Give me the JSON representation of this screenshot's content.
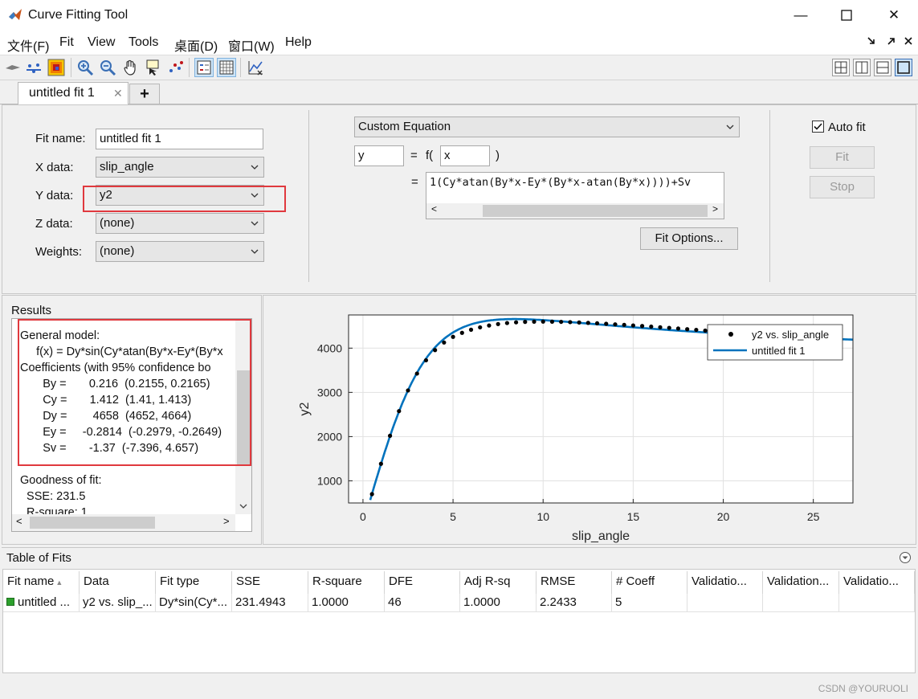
{
  "window": {
    "title": "Curve Fitting Tool",
    "minimize_glyph": "—",
    "maximize_glyph": "☐",
    "close_glyph": "✕"
  },
  "menu": {
    "items": [
      "文件(F)",
      "Fit",
      "View",
      "Tools",
      "桌面(D)",
      "窗口(W)",
      "Help"
    ]
  },
  "tabs": [
    {
      "label": "untitled fit 1",
      "close": "✕"
    },
    {
      "label": "+"
    }
  ],
  "fit_panel": {
    "fit_name_label": "Fit name:",
    "fit_name_value": "untitled fit 1",
    "x_label": "X data:",
    "x_value": "slip_angle",
    "y_label": "Y data:",
    "y_value": "y2",
    "z_label": "Z data:",
    "z_value": "(none)",
    "w_label": "Weights:",
    "w_value": "(none)"
  },
  "equation_panel": {
    "type": "Custom Equation",
    "lhs": "y",
    "equals": "=",
    "f_open": "f(",
    "var": "x",
    "f_close": ")",
    "eq_equals": "=",
    "equation": "1(Cy*atan(By*x-Ey*(By*x-atan(By*x))))+Sv",
    "fit_options": "Fit Options..."
  },
  "controls": {
    "auto_fit_label": "Auto fit",
    "auto_fit_checked": true,
    "fit_button": "Fit",
    "stop_button": "Stop"
  },
  "results": {
    "title": "Results",
    "lines": [
      "General model:",
      "     f(x) = Dy*sin(Cy*atan(By*x-Ey*(By*x",
      "Coefficients (with 95% confidence bo",
      "       By =       0.216  (0.2155, 0.2165)",
      "       Cy =       1.412  (1.41, 1.413)",
      "       Dy =        4658  (4652, 4664)",
      "       Ey =     -0.2814  (-0.2979, -0.2649)",
      "       Sv =       -1.37  (-7.396, 4.657)",
      "",
      "Goodness of fit:",
      "  SSE: 231.5",
      "  R-square: 1"
    ]
  },
  "chart_data": {
    "type": "scatter",
    "xlabel": "slip_angle",
    "ylabel": "y2",
    "xlim": [
      -0.8,
      27.2
    ],
    "ylim": [
      500,
      4750
    ],
    "xticks": [
      0,
      5,
      10,
      15,
      20,
      25
    ],
    "yticks": [
      1000,
      2000,
      3000,
      4000
    ],
    "grid": true,
    "legend_position": "top-right",
    "model": {
      "By": 0.216,
      "Cy": 1.412,
      "Dy": 4658,
      "Ey": -0.2814,
      "Sv": -1.37
    },
    "series": [
      {
        "name": "y2 vs. slip_angle",
        "style": "markers",
        "x": [
          0.5,
          1.0,
          1.5,
          2.0,
          2.5,
          3.0,
          3.5,
          4.0,
          4.5,
          5.0,
          5.5,
          6.0,
          6.5,
          7.0,
          7.5,
          8.0,
          8.5,
          9.0,
          9.5,
          10.0,
          10.5,
          11.0,
          11.5,
          12.0,
          12.5,
          13.0,
          13.5,
          14.0,
          14.5,
          15.0,
          15.5,
          16.0,
          16.5,
          17.0,
          17.5,
          18.0,
          18.5,
          19.0
        ],
        "y": [
          700,
          1385,
          2019,
          2576,
          3044,
          3425,
          3725,
          3955,
          4127,
          4255,
          4346,
          4416,
          4470,
          4512,
          4544,
          4567,
          4583,
          4593,
          4598,
          4600,
          4598,
          4594,
          4588,
          4580,
          4571,
          4561,
          4550,
          4538,
          4526,
          4513,
          4500,
          4486,
          4472,
          4458,
          4443,
          4428,
          4413,
          4397
        ]
      },
      {
        "name": "untitled fit 1",
        "style": "line",
        "x_range": [
          0.2,
          27.2
        ]
      }
    ]
  },
  "table_of_fits": {
    "title": "Table of Fits",
    "columns": [
      "Fit name",
      "Data",
      "Fit type",
      "SSE",
      "R-square",
      "DFE",
      "Adj R-sq",
      "RMSE",
      "# Coeff",
      "Validatio...",
      "Validation...",
      "Validatio..."
    ],
    "sort_indicator": "▲",
    "rows": [
      [
        "untitled ...",
        "y2 vs. slip_...",
        "Dy*sin(Cy*...",
        "231.4943",
        "1.0000",
        "46",
        "1.0000",
        "2.2433",
        "5",
        "",
        "",
        ""
      ]
    ],
    "status_color": "#2ca02c"
  },
  "watermark": "CSDN @YOURUOLI",
  "colors": {
    "accent": "#0072bd",
    "highlight": "#e0393e"
  }
}
